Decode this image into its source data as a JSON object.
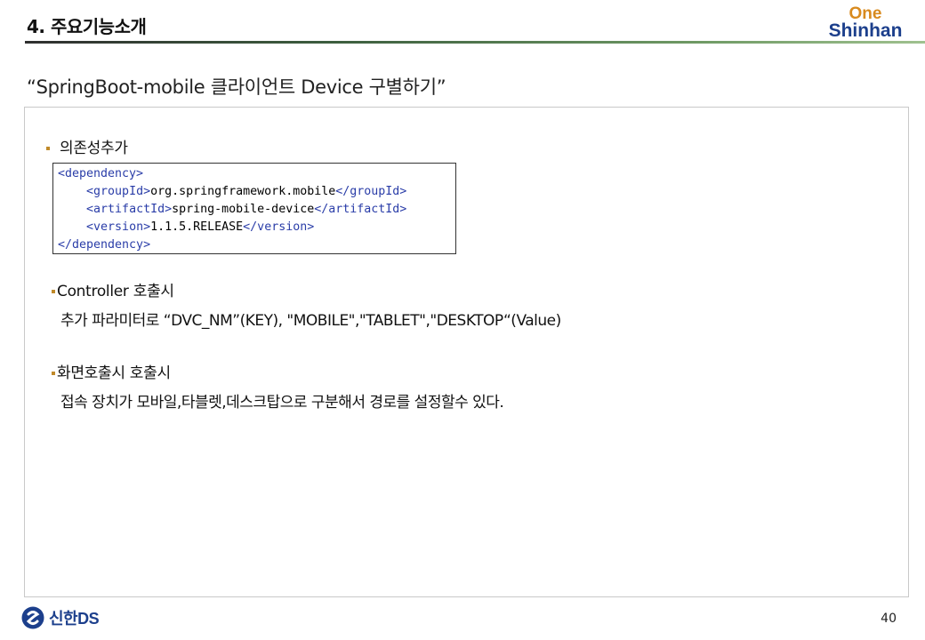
{
  "header": {
    "section_title": "4. 주요기능소개",
    "logo_top": "One",
    "logo_bottom": "Shinhan"
  },
  "slide_title": "“SpringBoot-mobile 클라이언트 Device 구별하기”",
  "sections": [
    {
      "bullet": "의존성추가"
    },
    {
      "bullet": "Controller 호출시",
      "text": "추가 파라미터로 “DVC_NM”(KEY), \"MOBILE\",\"TABLET\",\"DESKTOP“(Value)"
    },
    {
      "bullet": "화면호출시 호출시",
      "text": "접속 장치가 모바일,타블렛,데스크탑으로 구분해서 경로를 설정할수 있다."
    }
  ],
  "code": {
    "lines": [
      {
        "indent": "",
        "open": "<dependency>",
        "value": "",
        "close": ""
      },
      {
        "indent": "    ",
        "open": "<groupId>",
        "value": "org.springframework.mobile",
        "close": "</groupId>"
      },
      {
        "indent": "    ",
        "open": "<artifactId>",
        "value": "spring-mobile-device",
        "close": "</artifactId>"
      },
      {
        "indent": "    ",
        "open": "<version>",
        "value": "1.1.5.RELEASE",
        "close": "</version>"
      },
      {
        "indent": "",
        "open": "</dependency>",
        "value": "",
        "close": ""
      }
    ]
  },
  "footer": {
    "brand": "신한DS",
    "page_number": "40"
  },
  "colors": {
    "bullet": "#c08a2a",
    "code_tag": "#2a3da8",
    "brand_blue": "#1c3f8c",
    "brand_orange": "#d88a1e"
  }
}
